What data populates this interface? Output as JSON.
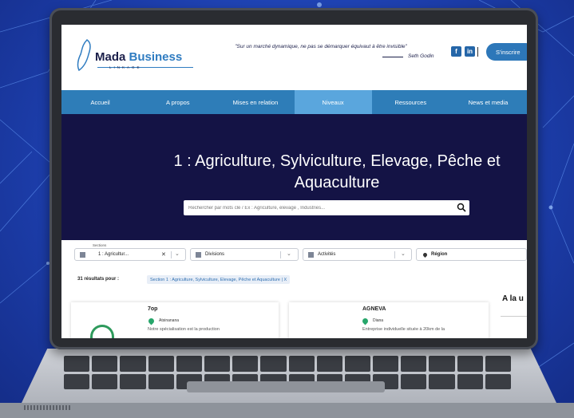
{
  "site": {
    "logo": {
      "name_part1": "Mada",
      "name_part2": " Business",
      "tagline": "LINKAGE"
    },
    "quote": "\"Sur un marché dynamique, ne pas se démarquer équivaut à être invisible\"",
    "quote_author": "Seth Godin",
    "social": {
      "facebook": "f",
      "linkedin": "in"
    },
    "signup_label": "S'inscrire"
  },
  "nav": {
    "items": [
      {
        "label": "Accueil"
      },
      {
        "label": "A propos"
      },
      {
        "label": "Mises en relation"
      },
      {
        "label": "Niveaux"
      },
      {
        "label": "Ressources"
      },
      {
        "label": "News et media"
      }
    ],
    "active_index": 3
  },
  "hero": {
    "title_line1": "1 : Agriculture, Sylviculture, Elevage, Pêche et",
    "title_line2": "Aquaculture",
    "search_placeholder": "Rechercher par mots clé / Ex : Agriculture, élevage , Industries..."
  },
  "filters": {
    "sections": {
      "label": "Sections",
      "value": "1 : Agricultur..."
    },
    "divisions": {
      "value": "Divisions"
    },
    "activites": {
      "value": "Activités"
    },
    "region": {
      "value": "Région"
    }
  },
  "results": {
    "count_text": "31 résultats pour :",
    "chip": "Section 1 : Agriculture, Sylviculture, Elevage, Pêche et Aquaculture  |  X"
  },
  "cards": [
    {
      "name": "7op",
      "location": "Atsinanana",
      "desc": "Notre   spécialisation   est   la   production"
    },
    {
      "name": "AGNEVA",
      "location": "Diana",
      "desc": "Entreprise individuelle située à 20km de la"
    }
  ],
  "aside": {
    "title": "A la u"
  },
  "colors": {
    "nav": "#2e7db8",
    "nav_active": "#5aa6dd",
    "hero": "#141345",
    "brand_dark": "#1b1f4a",
    "pin": "#27a66b"
  }
}
